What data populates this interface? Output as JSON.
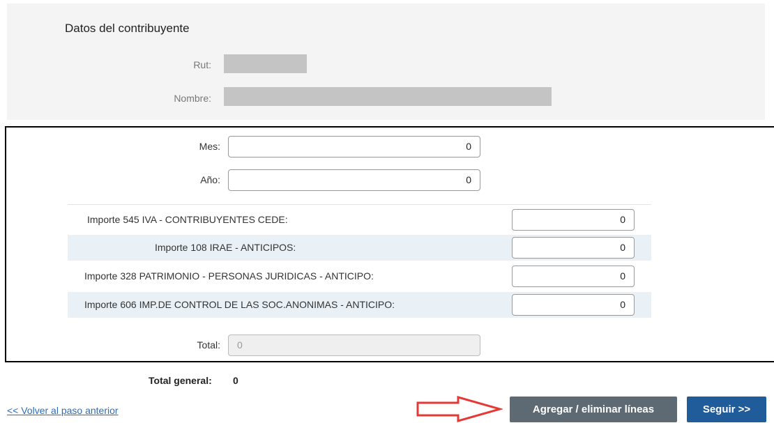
{
  "taxpayer": {
    "title": "Datos del contribuyente",
    "rut_label": "Rut:",
    "nombre_label": "Nombre:"
  },
  "form": {
    "mes_label": "Mes:",
    "mes_value": "0",
    "anio_label": "Año:",
    "anio_value": "0",
    "rows": [
      {
        "label": "Importe 545 IVA - CONTRIBUYENTES CEDE:",
        "value": "0"
      },
      {
        "label": "Importe 108 IRAE - ANTICIPOS:",
        "value": "0"
      },
      {
        "label": "Importe 328 PATRIMONIO - PERSONAS JURIDICAS - ANTICIPO:",
        "value": "0"
      },
      {
        "label": "Importe 606 IMP.DE CONTROL DE LAS SOC.ANONIMAS - ANTICIPO:",
        "value": "0"
      }
    ],
    "total_label": "Total:",
    "total_value": "0"
  },
  "totals": {
    "general_label": "Total general:",
    "general_value": "0"
  },
  "footer": {
    "back_link": "<< Volver al paso anterior",
    "lines_button": "Agregar / eliminar líneas",
    "next_button": "Seguir >>"
  },
  "colors": {
    "annotation_arrow": "#e53935",
    "primary_button": "#1f5c99",
    "secondary_button": "#5e6a73",
    "shaded_row": "#eaf1f6"
  }
}
